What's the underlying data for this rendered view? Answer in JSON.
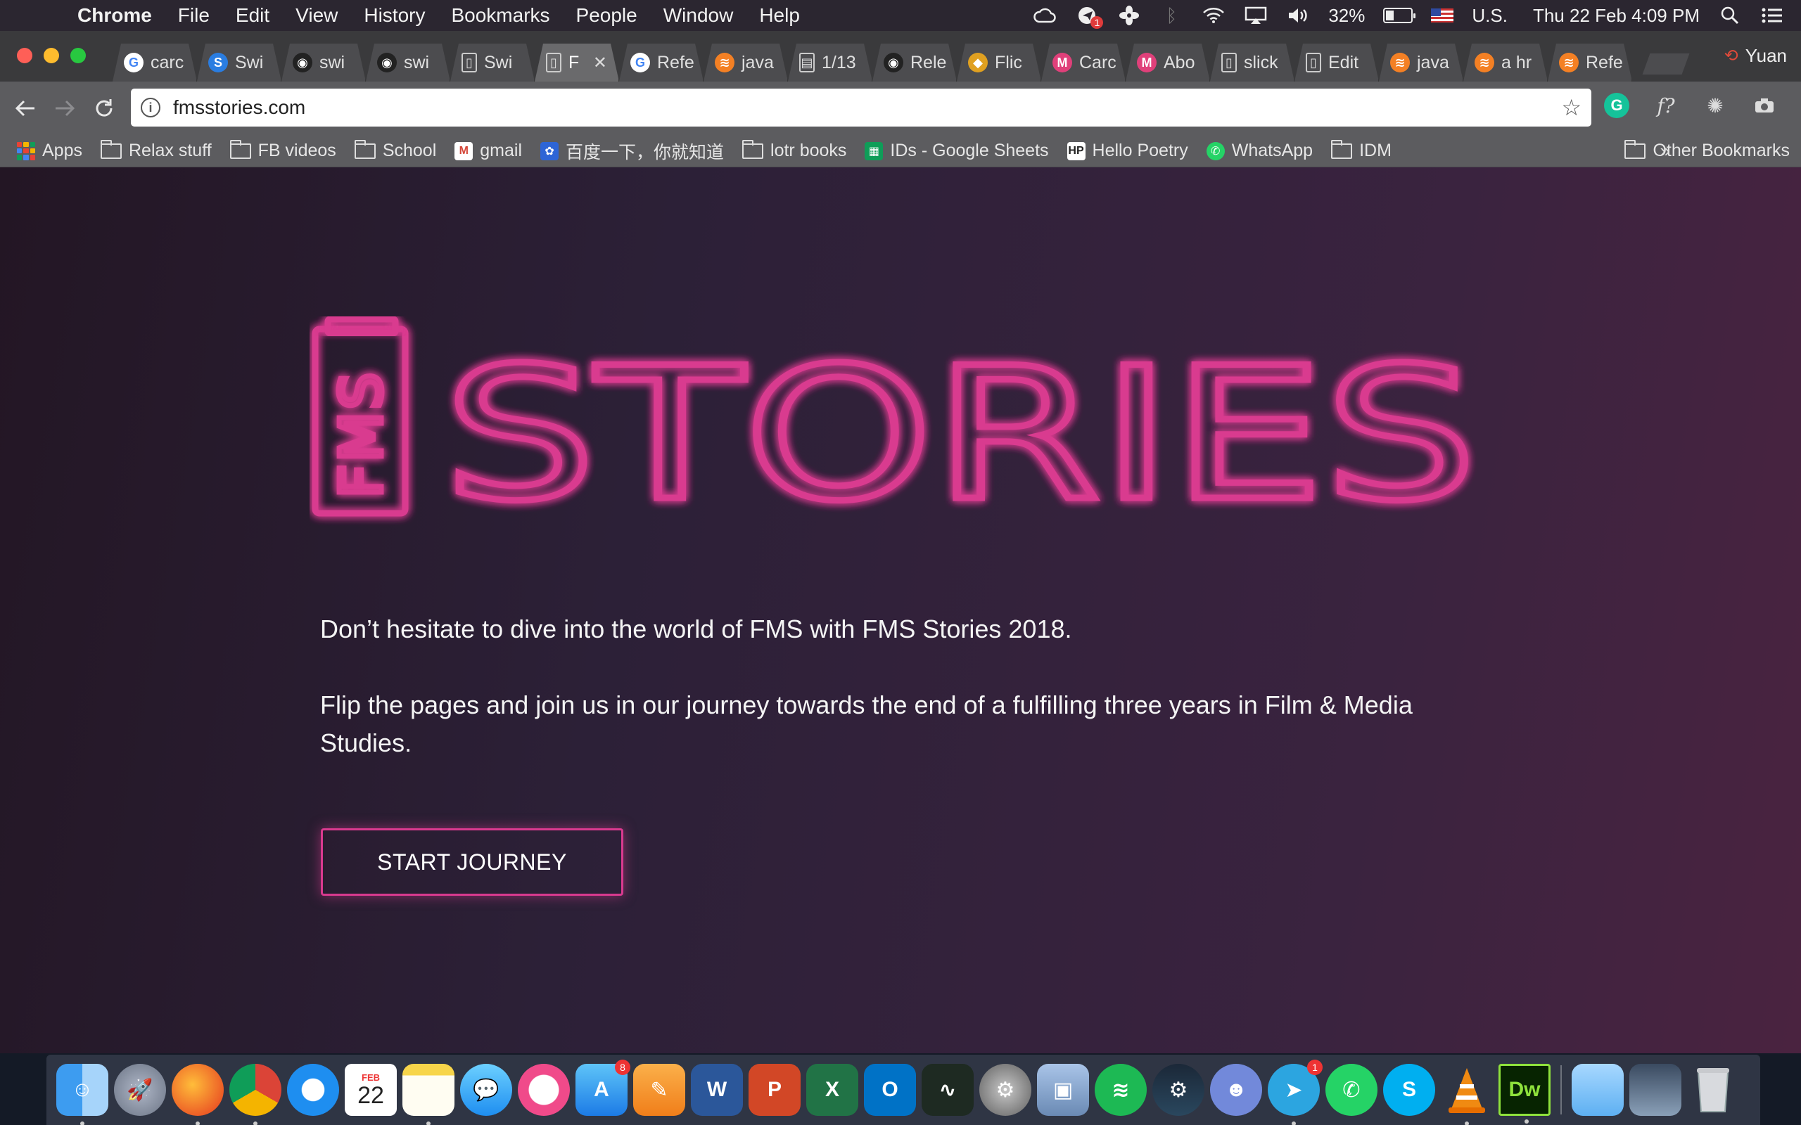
{
  "menubar": {
    "app_name": "Chrome",
    "menus": [
      "File",
      "Edit",
      "View",
      "History",
      "Bookmarks",
      "People",
      "Window",
      "Help"
    ],
    "battery_percent": "32%",
    "battery_level": 0.32,
    "input_source": "U.S.",
    "clock": "Thu 22 Feb  4:09 PM",
    "notification_badge": "1"
  },
  "tabs": [
    {
      "label": "carc",
      "icon": "google-icon",
      "color": "#ffffff"
    },
    {
      "label": "Swi",
      "icon": "swiper-icon",
      "color": "#2a7de1"
    },
    {
      "label": "swi",
      "icon": "github-icon",
      "color": "#222222"
    },
    {
      "label": "swi",
      "icon": "github-icon",
      "color": "#222222"
    },
    {
      "label": "Swi",
      "icon": "page-icon",
      "color": "#666666"
    },
    {
      "label": "F",
      "icon": "page-icon",
      "color": "#666666",
      "active": true
    },
    {
      "label": "Refe",
      "icon": "google-icon",
      "color": "#ffffff"
    },
    {
      "label": "java",
      "icon": "stackoverflow-icon",
      "color": "#f48024"
    },
    {
      "label": "1/13",
      "icon": "doc-icon",
      "color": "#3b6fb6"
    },
    {
      "label": "Rele",
      "icon": "github-icon",
      "color": "#222222"
    },
    {
      "label": "Flic",
      "icon": "flickity-icon",
      "color": "#e0a020"
    },
    {
      "label": "Carc",
      "icon": "m-icon",
      "color": "#e0407a"
    },
    {
      "label": "Abo",
      "icon": "m-icon",
      "color": "#e0407a"
    },
    {
      "label": "slick",
      "icon": "page-icon",
      "color": "#666666"
    },
    {
      "label": "Edit",
      "icon": "page-icon",
      "color": "#666666"
    },
    {
      "label": "java",
      "icon": "stackoverflow-icon",
      "color": "#f48024"
    },
    {
      "label": "a hr",
      "icon": "stackoverflow-icon",
      "color": "#f48024"
    },
    {
      "label": "Refe",
      "icon": "stackoverflow-icon",
      "color": "#f48024"
    }
  ],
  "profile_name": "Yuan",
  "omnibox": {
    "url": "fmsstories.com"
  },
  "bookmarks": [
    {
      "label": "Apps",
      "icon": "apps-grid-icon"
    },
    {
      "label": "Relax stuff",
      "icon": "folder-icon"
    },
    {
      "label": "FB videos",
      "icon": "folder-icon"
    },
    {
      "label": "School",
      "icon": "folder-icon"
    },
    {
      "label": "gmail",
      "icon": "gmail-icon"
    },
    {
      "label": "百度一下，你就知道",
      "icon": "baidu-icon"
    },
    {
      "label": "lotr books",
      "icon": "folder-icon"
    },
    {
      "label": "IDs - Google Sheets",
      "icon": "sheets-icon"
    },
    {
      "label": "Hello Poetry",
      "icon": "hp-icon"
    },
    {
      "label": "WhatsApp",
      "icon": "whatsapp-icon"
    },
    {
      "label": "IDM",
      "icon": "folder-icon"
    }
  ],
  "bookmarks_more": "»",
  "other_bookmarks": "Other Bookmarks",
  "page": {
    "logo_side_text": "FMS",
    "logo_main_text": "STORIES",
    "paragraph1": "Don’t hesitate to dive into the world of FMS with FMS Stories 2018.",
    "paragraph2": "Flip the pages and join us in our journey towards the end of a fulfilling three years in Film & Media Studies.",
    "cta_label": "START JOURNEY",
    "accent_color": "#d93a8f"
  },
  "dock": {
    "calendar_month": "FEB",
    "calendar_day": "22",
    "app_store_badge": "8",
    "telegram_badge": "1",
    "items": [
      "finder-icon",
      "launchpad-icon",
      "firefox-icon",
      "chrome-icon",
      "safari-icon",
      "calendar-icon",
      "notes-icon",
      "messages-icon",
      "itunes-icon",
      "app-store-icon",
      "pages-icon",
      "word-icon",
      "powerpoint-icon",
      "excel-icon",
      "outlook-icon",
      "activity-monitor-icon",
      "system-preferences-icon",
      "preview-icon",
      "spotify-icon",
      "steam-icon",
      "discord-icon",
      "telegram-icon",
      "whatsapp-icon",
      "skype-icon",
      "vlc-icon",
      "dreamweaver-icon",
      "folder-icon",
      "screenshot-icon",
      "trash-icon"
    ]
  }
}
